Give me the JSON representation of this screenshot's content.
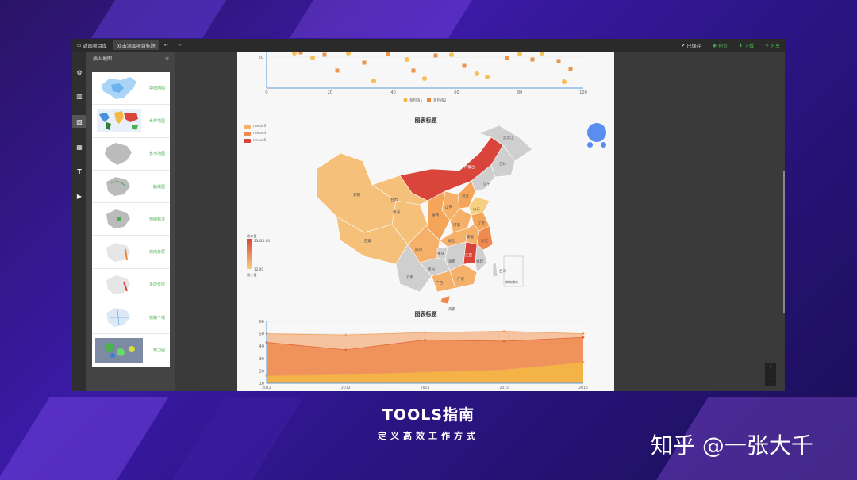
{
  "toolbar": {
    "back_label": "返回项目库",
    "project_title": "双击添加项目标题",
    "saved_label": "已保存",
    "preview_label": "预览",
    "download_label": "下载",
    "share_label": "分享"
  },
  "panel": {
    "title": "插入地图",
    "items": [
      {
        "label": "中国地图"
      },
      {
        "label": "世界地图"
      },
      {
        "label": "省市地图"
      },
      {
        "label": "航线图"
      },
      {
        "label": "地图标注"
      },
      {
        "label": "双向分层"
      },
      {
        "label": "多向分层"
      },
      {
        "label": "铁路干线"
      },
      {
        "label": "热力图"
      }
    ]
  },
  "scatter": {
    "legend": [
      "系列值1",
      "系列值2"
    ],
    "colors": [
      "#f5b942",
      "#e8883a"
    ],
    "x_ticks": [
      "0",
      "20",
      "40",
      "60",
      "80",
      "100"
    ],
    "y_tick": "20"
  },
  "map": {
    "title": "图表标题",
    "legend": [
      {
        "name": "nexus3",
        "color": "#f5b06a"
      },
      {
        "name": "nexus4",
        "color": "#ee8a50"
      },
      {
        "name": "nexus5",
        "color": "#d9453b"
      }
    ],
    "visual_max_label": "最大值",
    "visual_max_value": "23424.00",
    "visual_min_label": "最小值",
    "visual_min_value": "12.00",
    "inset_label": "南海诸岛",
    "provinces": {
      "xinjiang": "新疆",
      "xizang": "西藏",
      "qinghai": "青海",
      "gansu": "甘肃",
      "neimenggu": "内蒙古",
      "heilongjiang": "黑龙江",
      "jilin": "吉林",
      "liaoning": "辽宁",
      "sichuan": "四川",
      "yunnan": "云南",
      "guizhou": "贵州",
      "guangxi": "广西",
      "guangdong": "广东",
      "hunan": "湖南",
      "hubei": "湖北",
      "henan": "河南",
      "shandong": "山东",
      "jiangsu": "江苏",
      "zhejiang": "浙江",
      "fujian": "福建",
      "shaanxi": "陕西",
      "shanxi": "山西",
      "hebei": "河北",
      "jiangxi": "江西",
      "anhui": "安徽",
      "taiwan": "台湾",
      "hainan": "海南",
      "chongqing": "重庆"
    }
  },
  "chart_data": {
    "type": "area",
    "title": "图表标题",
    "x": [
      "2012",
      "2013",
      "2014",
      "2015",
      "2016"
    ],
    "ylim": [
      10,
      60
    ],
    "yticks": [
      10,
      20,
      30,
      40,
      50,
      60
    ],
    "series": [
      {
        "values": [
          50,
          49,
          51,
          52,
          50
        ],
        "color": "#f5b58a"
      },
      {
        "values": [
          43,
          37,
          45,
          44,
          47
        ],
        "color": "#ee8a50"
      },
      {
        "values": [
          16,
          17,
          19,
          21,
          27
        ],
        "color": "#f5b942"
      }
    ]
  },
  "brand": {
    "name": "TOOLS指南",
    "slogan": "定义高效工作方式",
    "watermark": "知乎 @一张大千"
  }
}
